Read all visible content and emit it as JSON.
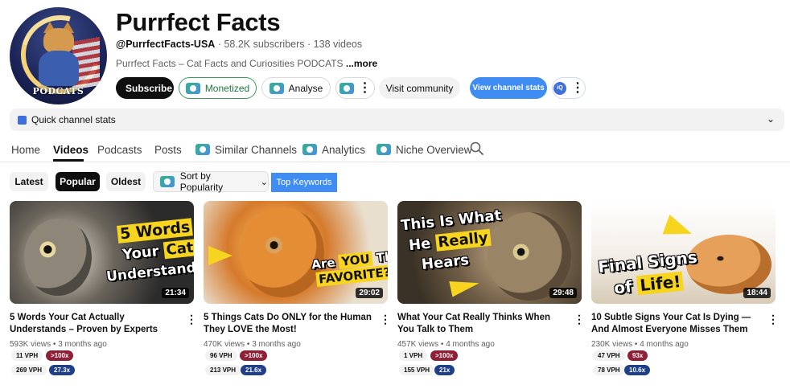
{
  "channel": {
    "name": "Purrfect Facts",
    "handle": "@PurrfectFacts-USA",
    "subscribers": "58.2K subscribers",
    "videos": "138 videos",
    "separator": "·",
    "description": "Purrfect Facts – Cat Facts and Curiosities PODCATS",
    "more": "...more",
    "avatar_text": "PODCATS"
  },
  "actions": {
    "subscribe": "Subscribe",
    "monetized": "Monetized",
    "analyse": "Analyse",
    "visit_community": "Visit community",
    "view_channel_stats": "View channel stats"
  },
  "quick_stats": {
    "label": "Quick channel stats"
  },
  "tabs": [
    {
      "label": "Home"
    },
    {
      "label": "Videos"
    },
    {
      "label": "Podcasts"
    },
    {
      "label": "Posts"
    },
    {
      "label": "Similar Channels"
    },
    {
      "label": "Analytics"
    },
    {
      "label": "Niche Overview"
    }
  ],
  "filters": {
    "latest": "Latest",
    "popular": "Popular",
    "oldest": "Oldest",
    "sort": "Sort by Popularity",
    "top_keywords": "Top Keywords"
  },
  "videos": [
    {
      "title": "5 Words Your Cat Actually Understands – Proven by Experts",
      "views": "593K views",
      "age": "3 months ago",
      "duration": "21:34",
      "vph1": "11 VPH",
      "mult1": ">100x",
      "vph2": "269 VPH",
      "mult2": "27.3x",
      "thumb_line1": "5 Words",
      "thumb_line2a": "Your ",
      "thumb_line2b": "Cat",
      "thumb_line3": "Understands!"
    },
    {
      "title": "5 Things Cats Do ONLY for the Human They LOVE the Most!",
      "views": "470K views",
      "age": "3 months ago",
      "duration": "29:02",
      "vph1": "96 VPH",
      "mult1": ">100x",
      "vph2": "213 VPH",
      "mult2": "21.6x",
      "thumb_line1a": "Are ",
      "thumb_line1b": "YOU",
      "thumb_line1c": " Their",
      "thumb_line2": "FAVORITE?"
    },
    {
      "title": "What Your Cat Really Thinks When You Talk to Them",
      "views": "457K views",
      "age": "4 months ago",
      "duration": "29:48",
      "vph1": "1 VPH",
      "mult1": ">100x",
      "vph2": "155 VPH",
      "mult2": "21x",
      "thumb_line1": "This Is What",
      "thumb_line2a": "He ",
      "thumb_line2b": "Really",
      "thumb_line3": "Hears"
    },
    {
      "title": "10 Subtle Signs Your Cat Is Dying — And Almost Everyone Misses Them",
      "views": "230K views",
      "age": "4 months ago",
      "duration": "18:44",
      "vph1": "47 VPH",
      "mult1": "93x",
      "vph2": "78 VPH",
      "mult2": "10.6x",
      "thumb_line1": "Final Signs",
      "thumb_line2a": "of ",
      "thumb_line2b": "Life!"
    }
  ],
  "colors": {
    "accent_blue": "#3f8cf2",
    "monetized_green": "#1d7a3b",
    "multiplier_red": "#8f1f36",
    "multiplier_blue": "#1f3f8a"
  }
}
